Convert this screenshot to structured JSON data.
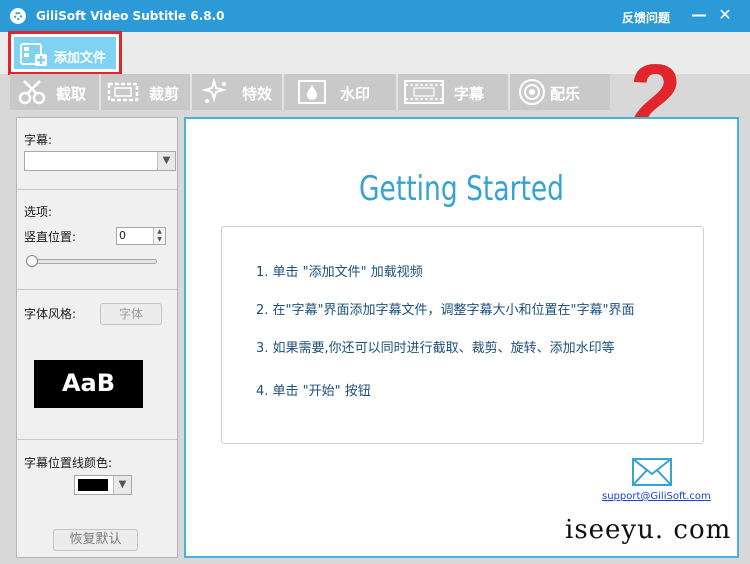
{
  "window": {
    "title": "GiliSoft Video Subtitle 6.8.0",
    "feedback_label": "反馈问题",
    "minimize_glyph": "—",
    "close_glyph": "✕"
  },
  "toolbar": {
    "add_file_label": "添加文件"
  },
  "tabs": [
    {
      "label": "截取",
      "icon": "scissors-icon"
    },
    {
      "label": "裁剪",
      "icon": "crop-frame-icon"
    },
    {
      "label": "特效",
      "icon": "sparkle-icon"
    },
    {
      "label": "水印",
      "icon": "droplet-icon"
    },
    {
      "label": "字幕",
      "icon": "film-subtitle-icon"
    },
    {
      "label": "配乐",
      "icon": "speaker-icon"
    }
  ],
  "annotation": {
    "step_number": "2",
    "color": "#e0262b"
  },
  "left_panel": {
    "subtitle_label": "字幕:",
    "subtitle_value": "",
    "options_label": "选项:",
    "vertical_position_label": "竖直位置:",
    "vertical_position_value": "0",
    "font_style_label": "字体风格:",
    "font_button": "字体",
    "preview_text": "AaB",
    "line_color_label": "字幕位置线颜色:",
    "line_color_value": "#000000",
    "restore_button": "恢复默认"
  },
  "main": {
    "title": "Getting Started",
    "steps": [
      "1. 单击 \"添加文件\" 加载视频",
      "2. 在\"字幕\"界面添加字幕文件，调整字幕大小和位置在\"字幕\"界面",
      "3. 如果需要,你还可以同时进行截取、裁剪、旋转、添加水印等",
      "4. 单击 \"开始\" 按钮"
    ],
    "support_email": "support@GiliSoft.com"
  },
  "watermark": "iseeyu. com",
  "colors": {
    "titlebar": "#2c9ad6",
    "accent": "#36a3d2",
    "highlight": "#e0262b"
  }
}
